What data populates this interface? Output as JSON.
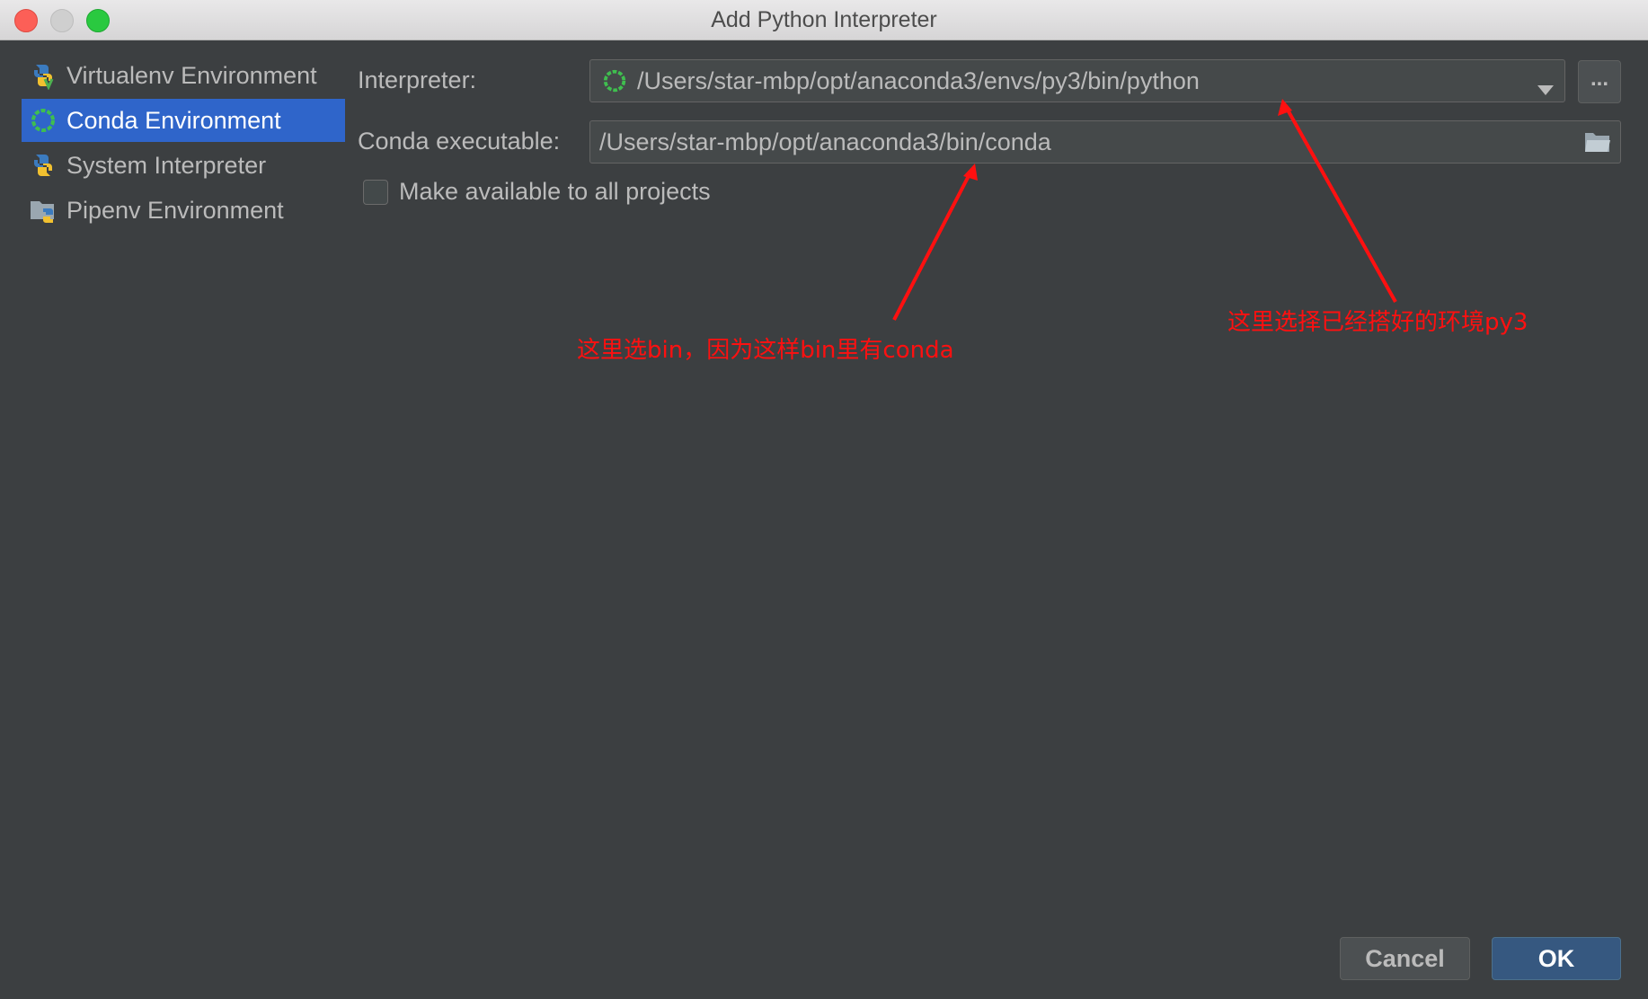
{
  "window": {
    "title": "Add Python Interpreter"
  },
  "sidebar": {
    "items": [
      {
        "label": "Virtualenv Environment",
        "icon": "python-virtualenv-icon",
        "selected": false
      },
      {
        "label": "Conda Environment",
        "icon": "conda-icon",
        "selected": true
      },
      {
        "label": "System Interpreter",
        "icon": "python-icon",
        "selected": false
      },
      {
        "label": "Pipenv Environment",
        "icon": "pipenv-folder-icon",
        "selected": false
      }
    ]
  },
  "form": {
    "interpreter_label": "Interpreter:",
    "interpreter_value": "/Users/star-mbp/opt/anaconda3/envs/py3/bin/python",
    "browse_button": "...",
    "conda_label": "Conda executable:",
    "conda_value": "/Users/star-mbp/opt/anaconda3/bin/conda",
    "make_available_label": "Make available to all projects",
    "make_available_checked": false
  },
  "annotations": {
    "bin_note": "这里选bin，因为这样bin里有conda",
    "env_note": "这里选择已经搭好的环境py3",
    "color": "#ff1010"
  },
  "buttons": {
    "cancel": "Cancel",
    "ok": "OK"
  },
  "colors": {
    "background": "#3c3f41",
    "selection": "#2f65ca",
    "ok_button": "#365880"
  }
}
